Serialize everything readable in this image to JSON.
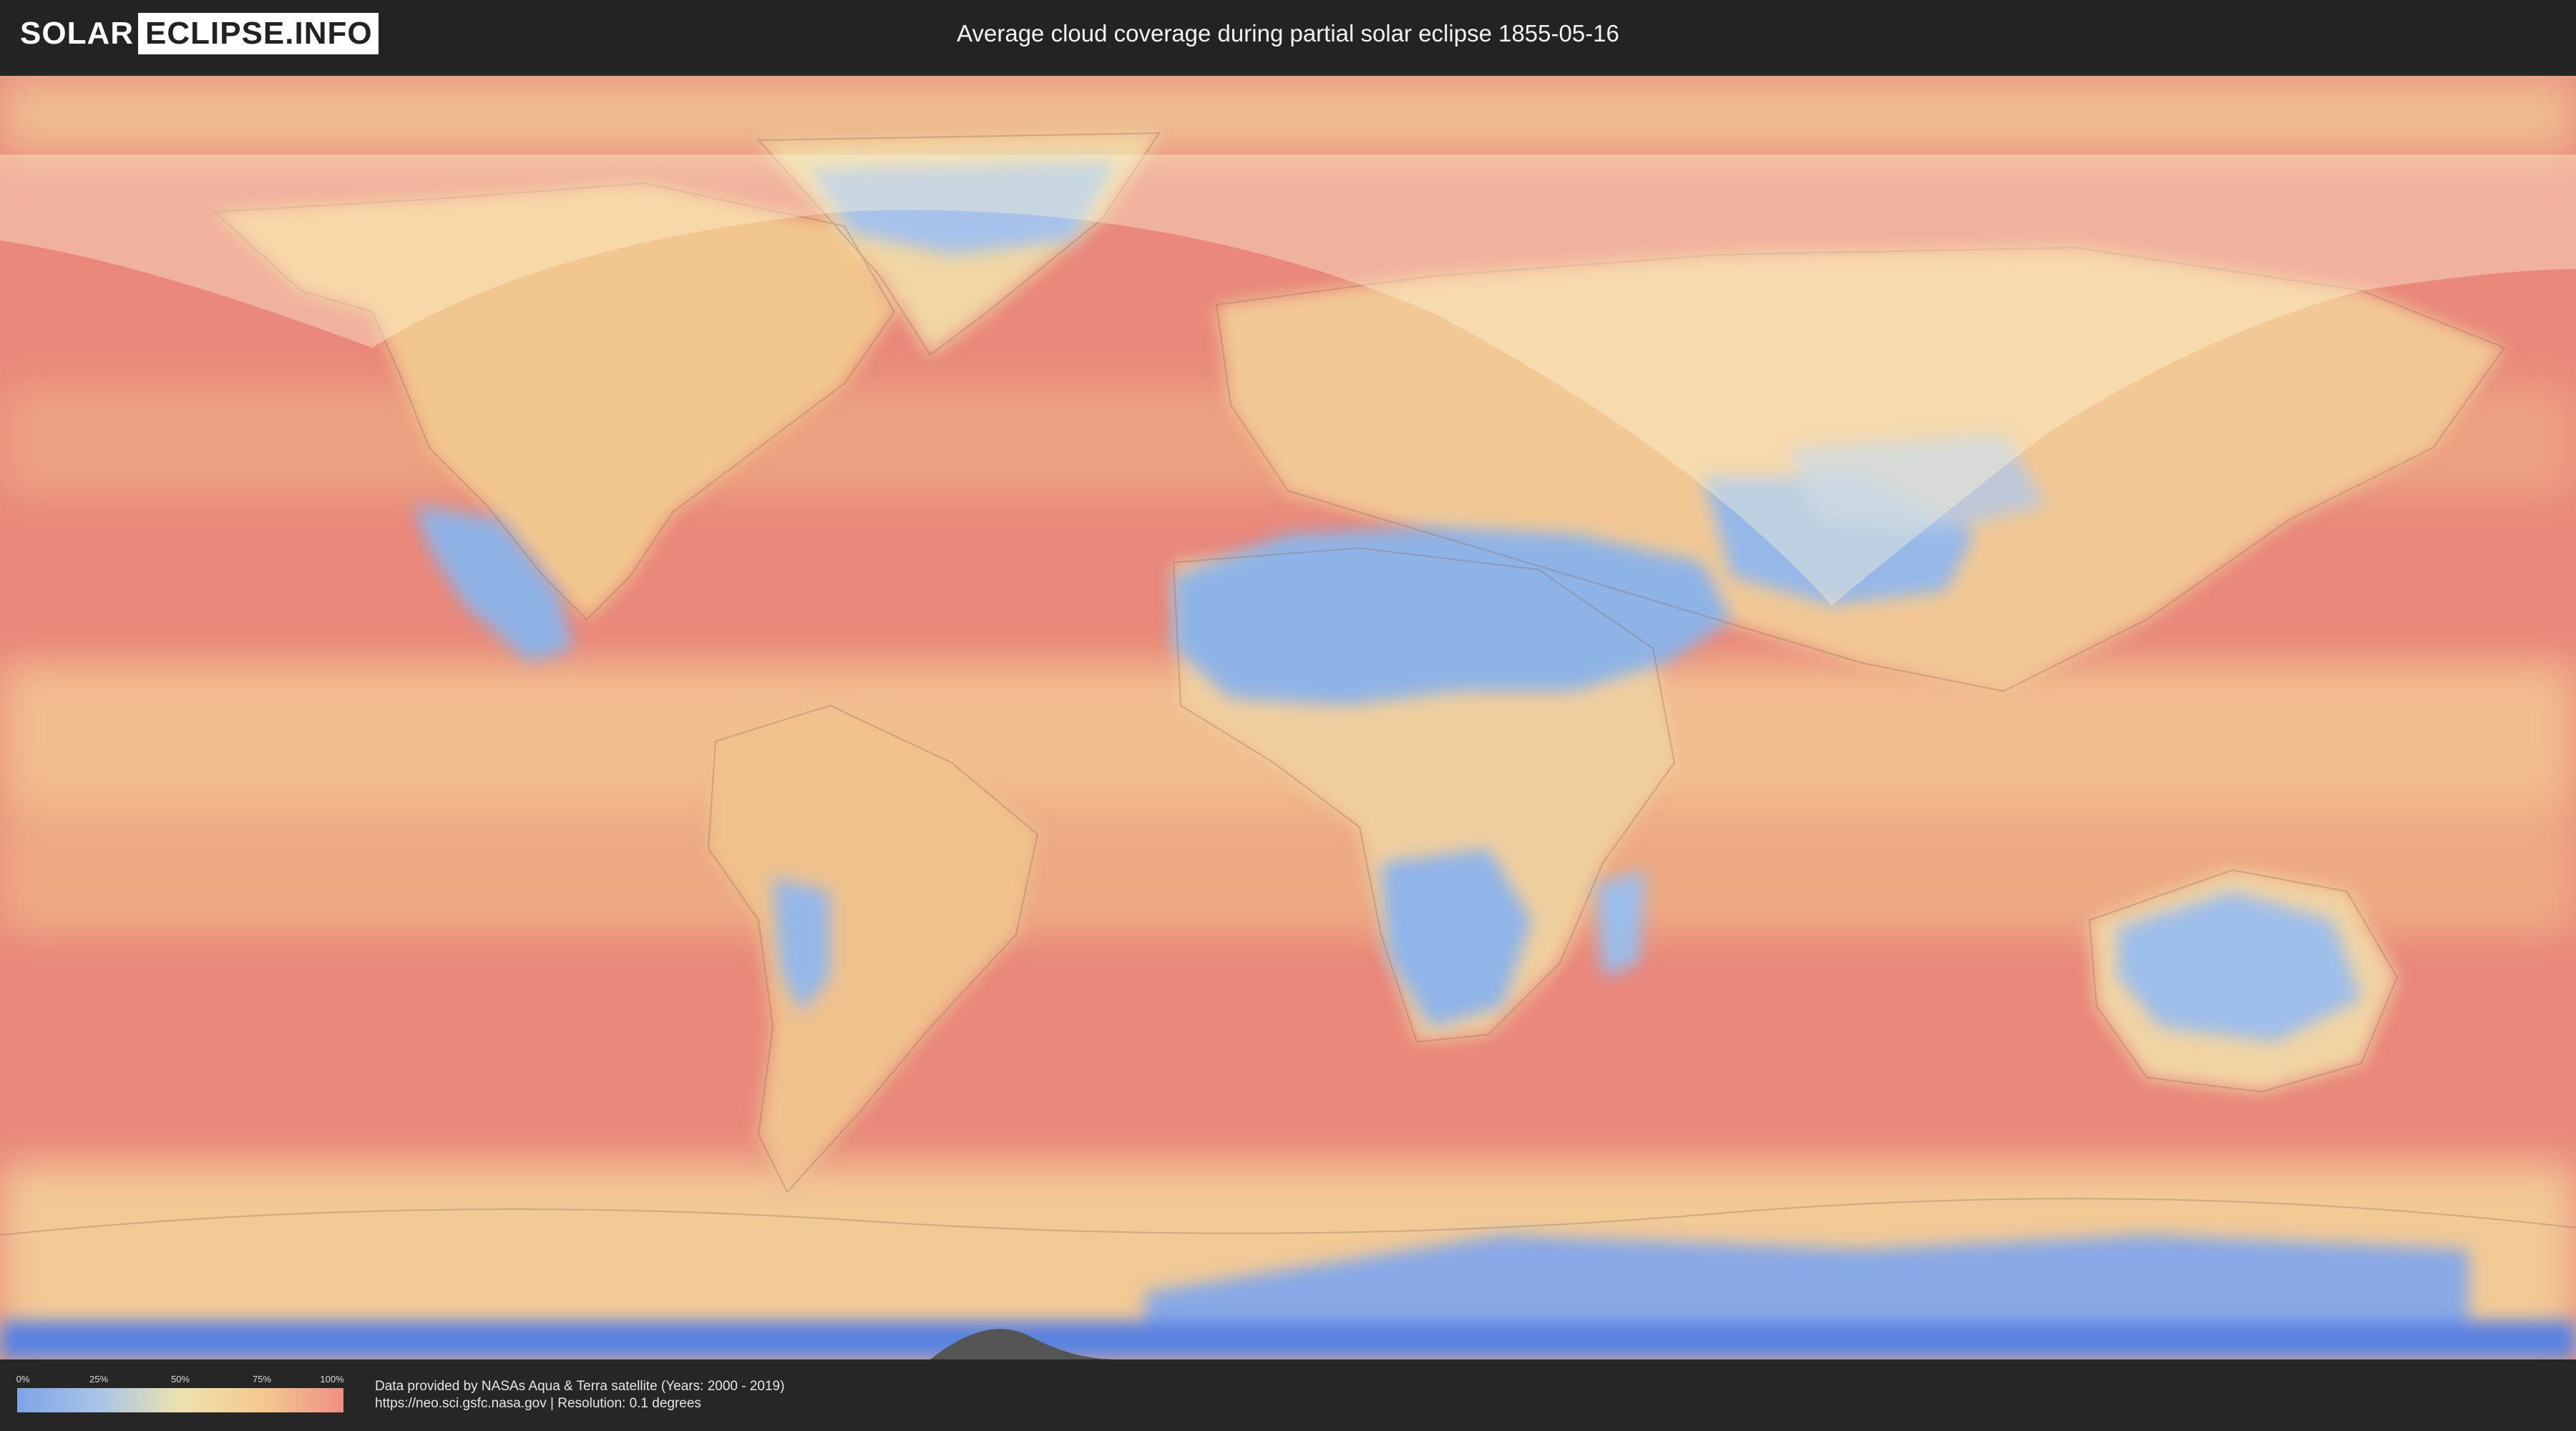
{
  "header": {
    "logo_left": "SOLAR",
    "logo_right": "ECLIPSE.INFO",
    "title": "Average cloud coverage during partial solar eclipse 1855-05-16"
  },
  "map": {
    "colors": {
      "ocean_cloudy": "#e9887b",
      "mid_cover": "#f2c48f",
      "land_light": "#f0d9a6",
      "clear_sky": "#8fb2e6",
      "polar_clear": "#6f8fe0",
      "eclipse_zone": "#fff6d6",
      "borders": "#8a6d5a"
    }
  },
  "legend": {
    "ticks": [
      "0%",
      "25%",
      "50%",
      "75%",
      "100%"
    ],
    "gradient_colors": [
      "#7ea4e6",
      "#a8c4e8",
      "#ece2ae",
      "#f5c98f",
      "#ee8f83"
    ]
  },
  "footer": {
    "credit_line1": "Data provided by NASAs Aqua & Terra satellite (Years: 2000 - 2019)",
    "credit_line2": "https://neo.sci.gsfc.nasa.gov | Resolution: 0.1 degrees"
  }
}
